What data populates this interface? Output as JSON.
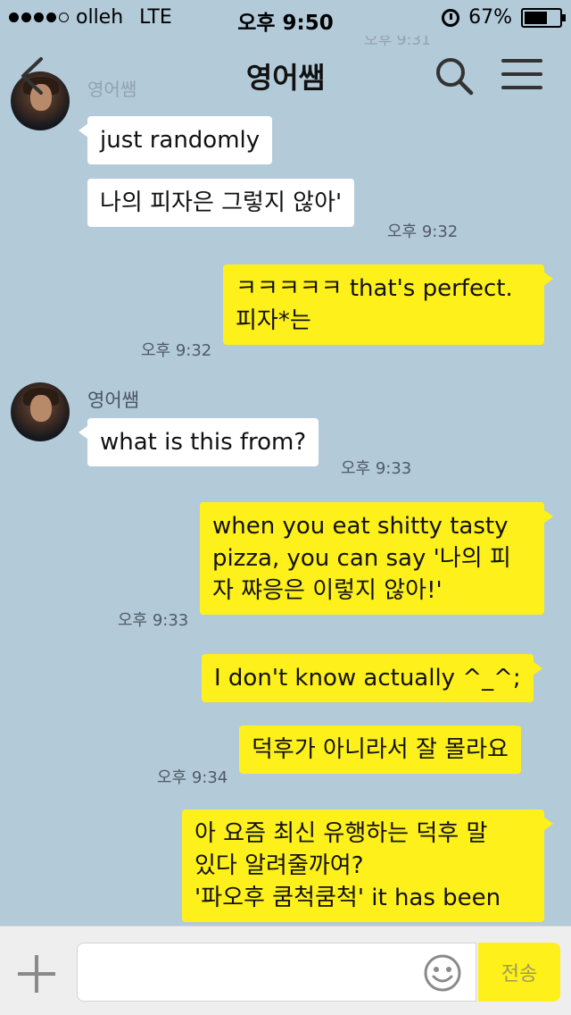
{
  "status_bar": {
    "carrier": "olleh",
    "network": "LTE",
    "time": "오후 9:50",
    "battery_text": "67%",
    "battery_level": 0.67
  },
  "header": {
    "title": "영어쌤",
    "icons": [
      "back-icon",
      "search-icon",
      "menu-icon"
    ]
  },
  "ghost": {
    "time": "오후 9:31",
    "name": "영어쌤"
  },
  "messages": [
    {
      "side": "left",
      "text": "just randomly"
    },
    {
      "side": "left",
      "text": "나의 피자은 그렇지 않아'",
      "time": "오후 9:32"
    },
    {
      "side": "right",
      "lines": [
        "ㅋㅋㅋㅋㅋ that's perfect.",
        "피자*는"
      ],
      "time": "오후 9:32"
    },
    {
      "side": "left",
      "sender": "영어쌤",
      "text": "what is this from?",
      "time": "오후 9:33"
    },
    {
      "side": "right",
      "lines": [
        "when you eat shitty tasty",
        "pizza, you can say '나의 피",
        "자 쨔응은 이렇지 않아!'"
      ],
      "time": "오후 9:33"
    },
    {
      "side": "right",
      "text": "I don't know actually ^_^;"
    },
    {
      "side": "right",
      "text": "덕후가 아니라서 잘 몰라요",
      "time": "오후 9:34"
    },
    {
      "side": "right",
      "lines": [
        "아 요즘 최신 유행하는 덕후 말",
        "있다 알려줄까여?",
        "'파오후 쿰척쿰척' it has been"
      ]
    }
  ],
  "input_bar": {
    "placeholder": "",
    "send_label": "전송",
    "icons": [
      "plus-icon",
      "emoticon-icon"
    ]
  },
  "colors": {
    "background": "#b3cad9",
    "my_bubble": "#fef01b",
    "their_bubble": "#ffffff"
  }
}
